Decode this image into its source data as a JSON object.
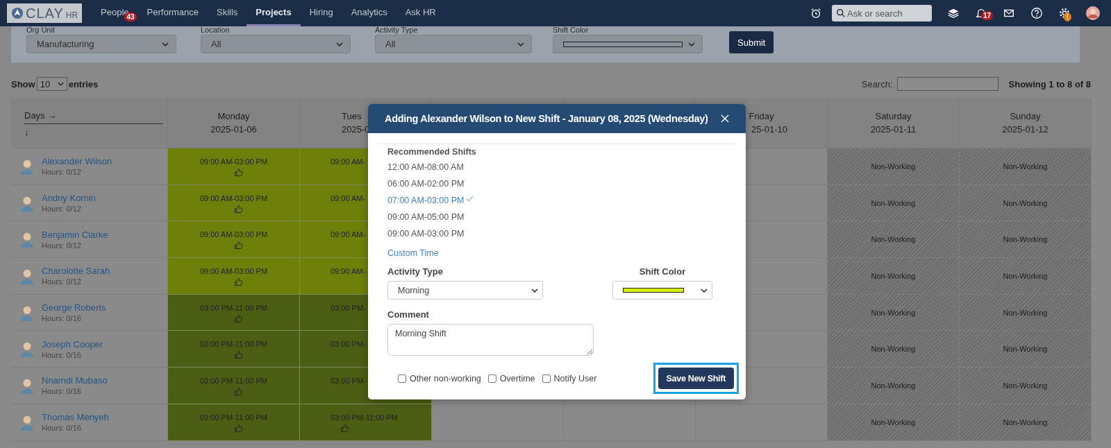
{
  "nav": {
    "logo": {
      "main": "CLAY",
      "sub": "HR"
    },
    "items": [
      {
        "label": "People",
        "selected": false,
        "badge": "43"
      },
      {
        "label": "Performance",
        "selected": false
      },
      {
        "label": "Skills",
        "selected": false
      },
      {
        "label": "Projects",
        "selected": true
      },
      {
        "label": "Hiring",
        "selected": false
      },
      {
        "label": "Analytics",
        "selected": false
      },
      {
        "label": "Ask HR",
        "selected": false
      }
    ],
    "search": {
      "placeholder": "Ask or search"
    },
    "notifications_badge": "17",
    "settings_badge": "!"
  },
  "filters": {
    "fields": [
      {
        "kind": "select",
        "label": "Org Unit",
        "value": "Manufacturing"
      },
      {
        "kind": "select",
        "label": "Location",
        "value": "All"
      },
      {
        "kind": "select",
        "label": "Activity Type",
        "value": "All"
      },
      {
        "kind": "swatch",
        "label": "Shift Color"
      }
    ],
    "submit": "Submit"
  },
  "table_controls": {
    "show": "Show",
    "page_size": "10",
    "entries": "entries",
    "search_label": "Search:",
    "info": "Showing 1 to 8 of 8"
  },
  "table": {
    "corner": {
      "across": "Days →",
      "down": "↓"
    },
    "columns": [
      {
        "day": "Monday",
        "date": "2025-01-06"
      },
      {
        "day": "Tues",
        "date": "2025-0"
      },
      {},
      {},
      {
        "day": "Friday",
        "date": "25-01-10"
      },
      {
        "day": "Saturday",
        "date": "2025-01-11"
      },
      {
        "day": "Sunday",
        "date": "2025-01-12"
      }
    ],
    "rows": [
      {
        "name": "Alexander Wilson",
        "hours": "Hours: 0/12",
        "cells": [
          {
            "kind": "shift",
            "time": "09:00 AM-03:00 PM",
            "thumbs_up": true,
            "color": "#6e8009"
          },
          {
            "kind": "shift",
            "time": "09:00 AM-",
            "thumbs_up": false,
            "color": "#6e8009"
          },
          {
            "kind": "empty"
          },
          {
            "kind": "empty"
          },
          {
            "kind": "empty"
          },
          {
            "kind": "non_working",
            "text": "Non-Working"
          },
          {
            "kind": "non_working",
            "text": "Non-Working"
          }
        ]
      },
      {
        "name": "Andriy Kornin",
        "hours": "Hours: 0/12",
        "cells": [
          {
            "kind": "shift",
            "time": "09:00 AM-03:00 PM",
            "thumbs_up": true,
            "color": "#6e8009"
          },
          {
            "kind": "shift",
            "time": "09:00 AM-",
            "thumbs_up": false,
            "color": "#6e8009"
          },
          {
            "kind": "empty"
          },
          {
            "kind": "empty"
          },
          {
            "kind": "empty"
          },
          {
            "kind": "non_working",
            "text": "Non-Working"
          },
          {
            "kind": "non_working",
            "text": "Non-Working"
          }
        ]
      },
      {
        "name": "Benjamin Clarke",
        "hours": "Hours: 0/12",
        "cells": [
          {
            "kind": "shift",
            "time": "09:00 AM-03:00 PM",
            "thumbs_up": true,
            "color": "#6e8009"
          },
          {
            "kind": "shift",
            "time": "09:00 AM-",
            "thumbs_up": false,
            "color": "#6e8009"
          },
          {
            "kind": "empty"
          },
          {
            "kind": "empty"
          },
          {
            "kind": "empty"
          },
          {
            "kind": "non_working",
            "text": "Non-Working"
          },
          {
            "kind": "non_working",
            "text": "Non-Working"
          }
        ]
      },
      {
        "name": "Charolotte Sarah",
        "hours": "Hours: 0/12",
        "cells": [
          {
            "kind": "shift",
            "time": "09:00 AM-03:00 PM",
            "thumbs_up": true,
            "color": "#6e8009"
          },
          {
            "kind": "shift",
            "time": "09:00 AM-",
            "thumbs_up": false,
            "color": "#6e8009"
          },
          {
            "kind": "empty"
          },
          {
            "kind": "empty"
          },
          {
            "kind": "empty"
          },
          {
            "kind": "non_working",
            "text": "Non-Working"
          },
          {
            "kind": "non_working",
            "text": "Non-Working"
          }
        ]
      },
      {
        "name": "George Roberts",
        "hours": "Hours: 0/16",
        "cells": [
          {
            "kind": "shift",
            "time": "03:00 PM-11:00 PM",
            "thumbs_up": true,
            "color": "#4b5e14"
          },
          {
            "kind": "shift",
            "time": "03:00 PM-",
            "thumbs_up": false,
            "color": "#4b5e14"
          },
          {
            "kind": "empty"
          },
          {
            "kind": "empty"
          },
          {
            "kind": "empty"
          },
          {
            "kind": "non_working",
            "text": "Non-Working"
          },
          {
            "kind": "non_working",
            "text": "Non-Working"
          }
        ]
      },
      {
        "name": "Joseph Cooper",
        "hours": "Hours: 0/16",
        "cells": [
          {
            "kind": "shift",
            "time": "03:00 PM-11:00 PM",
            "thumbs_up": true,
            "color": "#4b5e14"
          },
          {
            "kind": "shift",
            "time": "03:00 PM-",
            "thumbs_up": false,
            "color": "#4b5e14"
          },
          {
            "kind": "empty"
          },
          {
            "kind": "empty"
          },
          {
            "kind": "empty"
          },
          {
            "kind": "non_working",
            "text": "Non-Working"
          },
          {
            "kind": "non_working",
            "text": "Non-Working"
          }
        ]
      },
      {
        "name": "Nnamdi Mubaso",
        "hours": "Hours: 0/16",
        "cells": [
          {
            "kind": "shift",
            "time": "03:00 PM-11:00 PM",
            "thumbs_up": true,
            "color": "#4b5e14"
          },
          {
            "kind": "shift",
            "time": "03:00 PM-",
            "thumbs_up": false,
            "color": "#4b5e14"
          },
          {
            "kind": "empty"
          },
          {
            "kind": "empty"
          },
          {
            "kind": "empty"
          },
          {
            "kind": "non_working",
            "text": "Non-Working"
          },
          {
            "kind": "non_working",
            "text": "Non-Working"
          }
        ]
      },
      {
        "name": "Thomas Menyeh",
        "hours": "Hours: 0/16",
        "cells": [
          {
            "kind": "shift",
            "time": "03:00 PM-11:00 PM",
            "thumbs_up": true,
            "color": "#4b5e14"
          },
          {
            "kind": "shift",
            "time": "03:00 PM-11:00 PM",
            "thumbs_up": true,
            "color": "#4b5e14"
          },
          {
            "kind": "empty"
          },
          {
            "kind": "empty"
          },
          {
            "kind": "empty"
          },
          {
            "kind": "non_working",
            "text": "Non-Working"
          },
          {
            "kind": "non_working",
            "text": "Non-Working"
          }
        ]
      }
    ]
  },
  "modal": {
    "title": "Adding Alexander Wilson to New Shift - January 08, 2025 (Wednesday)",
    "recommended_title": "Recommended Shifts",
    "recommended": [
      {
        "label": "12:00 AM-08:00 AM",
        "selected": false
      },
      {
        "label": "06:00 AM-02:00 PM",
        "selected": false
      },
      {
        "label": "07:00 AM-03:00 PM",
        "selected": true
      },
      {
        "label": "09:00 AM-05:00 PM",
        "selected": false
      },
      {
        "label": "09:00 AM-03:00 PM",
        "selected": false
      }
    ],
    "custom_time": "Custom Time",
    "activity_type": {
      "label": "Activity Type",
      "value": "Morning"
    },
    "shift_color": {
      "label": "Shift Color",
      "color": "#d6f00c"
    },
    "comment": {
      "label": "Comment",
      "value": "Morning Shift"
    },
    "options": [
      {
        "label": "Other non-working",
        "checked": false
      },
      {
        "label": "Overtime",
        "checked": false
      },
      {
        "label": "Notify User",
        "checked": false
      }
    ],
    "save": {
      "label": "Save New Shift",
      "highlighted": true
    }
  }
}
